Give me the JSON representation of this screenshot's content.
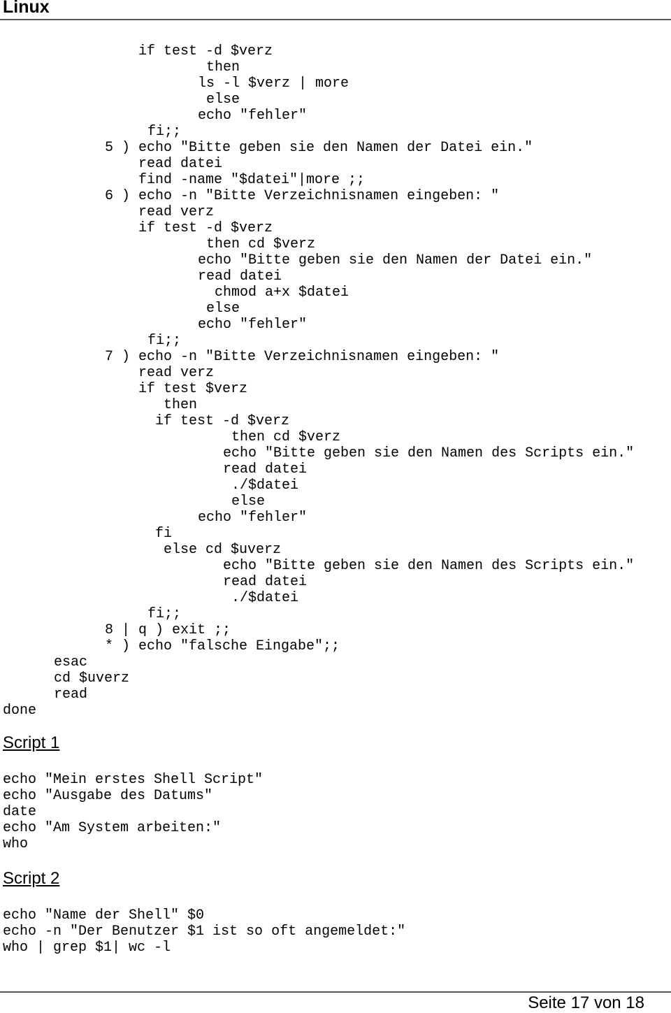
{
  "header": {
    "title": "Linux"
  },
  "menu_script": {
    "lines": [
      {
        "indent": 0,
        "text": "if test -d $verz"
      },
      {
        "indent": 1,
        "text": "then"
      },
      {
        "indent": 2,
        "text": "ls -l $verz | more"
      },
      {
        "indent": 3,
        "text": "else"
      },
      {
        "indent": 4,
        "text": "echo \"fehler\""
      },
      {
        "indent": 5,
        "text": "fi;;"
      },
      {
        "indent": 6,
        "text": "5 ) echo \"Bitte geben sie den Namen der Datei ein.\""
      },
      {
        "indent": 7,
        "text": "read datei"
      },
      {
        "indent": 8,
        "text": "find -name \"$datei\"|more ;;"
      },
      {
        "indent": 9,
        "text": "6 ) echo -n \"Bitte Verzeichnisnamen eingeben: \""
      },
      {
        "indent": 10,
        "text": "read verz"
      },
      {
        "indent": 11,
        "text": "if test -d $verz"
      },
      {
        "indent": 12,
        "text": "then cd $verz"
      },
      {
        "indent": 13,
        "text": "echo \"Bitte geben sie den Namen der Datei ein.\""
      },
      {
        "indent": 14,
        "text": "read datei"
      },
      {
        "indent": 15,
        "text": "chmod a+x $datei"
      },
      {
        "indent": 16,
        "text": "else"
      },
      {
        "indent": 17,
        "text": "echo \"fehler\""
      },
      {
        "indent": 18,
        "text": "fi;;"
      },
      {
        "indent": 19,
        "text": "7 ) echo -n \"Bitte Verzeichnisnamen eingeben: \""
      },
      {
        "indent": 20,
        "text": "read verz"
      },
      {
        "indent": 21,
        "text": "if test $verz"
      },
      {
        "indent": 22,
        "text": "then"
      },
      {
        "indent": 23,
        "text": "if test -d $verz"
      },
      {
        "indent": 24,
        "text": "then cd $verz"
      },
      {
        "indent": 25,
        "text": "echo \"Bitte geben sie den Namen des Scripts ein.\""
      },
      {
        "indent": 26,
        "text": "read datei"
      },
      {
        "indent": 27,
        "text": "./$datei"
      },
      {
        "indent": 28,
        "text": "else"
      },
      {
        "indent": 29,
        "text": "echo \"fehler\""
      },
      {
        "indent": 30,
        "text": "fi"
      },
      {
        "indent": 31,
        "text": "else cd $uverz"
      },
      {
        "indent": 32,
        "text": "echo \"Bitte geben sie den Namen des Scripts ein.\""
      },
      {
        "indent": 33,
        "text": "read datei"
      },
      {
        "indent": 34,
        "text": "./$datei"
      },
      {
        "indent": 35,
        "text": "fi;;"
      },
      {
        "indent": 36,
        "text": "8 | q ) exit ;;"
      },
      {
        "indent": 37,
        "text": "* ) echo \"falsche Eingabe\";;"
      },
      {
        "indent": 38,
        "text": "esac"
      },
      {
        "indent": 39,
        "text": "cd $uverz"
      },
      {
        "indent": 40,
        "text": "read"
      },
      {
        "indent": 41,
        "text": "done"
      }
    ]
  },
  "script1": {
    "heading": "Script 1",
    "lines": [
      "echo \"Mein erstes Shell Script\"",
      "echo \"Ausgabe des Datums\"",
      "date",
      "echo \"Am System arbeiten:\"",
      "who"
    ]
  },
  "script2": {
    "heading": "Script 2",
    "lines": [
      "echo \"Name der Shell\" $0",
      "echo -n \"Der Benutzer $1 ist so oft angemeldet:\"",
      "who | grep $1| wc -l"
    ]
  },
  "footer": {
    "page_label": "Seite 17 von 18"
  }
}
